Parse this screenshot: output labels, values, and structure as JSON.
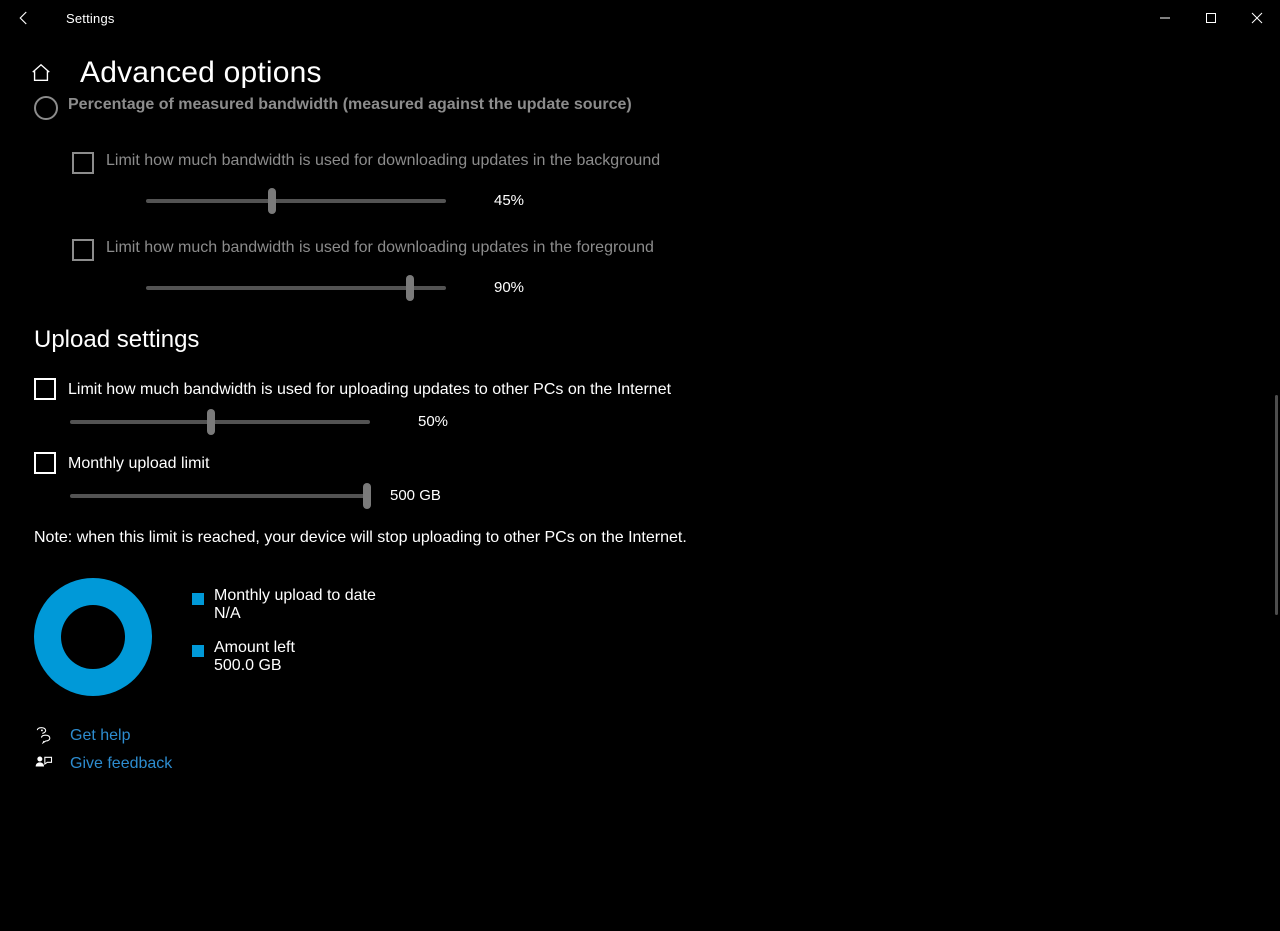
{
  "window": {
    "title": "Settings"
  },
  "page": {
    "title": "Advanced options"
  },
  "download": {
    "radio_label": "Percentage of measured bandwidth (measured against the update source)",
    "bg_checkbox_label": "Limit how much bandwidth is used for downloading updates in the background",
    "bg_value": "45%",
    "bg_percent": 45,
    "fg_checkbox_label": "Limit how much bandwidth is used for downloading updates in the foreground",
    "fg_value": "90%",
    "fg_percent": 90
  },
  "upload": {
    "section_title": "Upload settings",
    "bw_checkbox_label": "Limit how much bandwidth is used for uploading updates to other PCs on the Internet",
    "bw_value": "50%",
    "bw_percent": 50,
    "monthly_checkbox_label": "Monthly upload limit",
    "monthly_value": "500 GB",
    "monthly_percent": 100,
    "note": "Note: when this limit is reached, your device will stop uploading to other PCs on the Internet."
  },
  "usage": {
    "uploaded_label": "Monthly upload to date",
    "uploaded_value": "N/A",
    "left_label": "Amount left",
    "left_value": "500.0 GB"
  },
  "links": {
    "help": "Get help",
    "feedback": "Give feedback"
  },
  "colors": {
    "accent": "#0099d8"
  }
}
